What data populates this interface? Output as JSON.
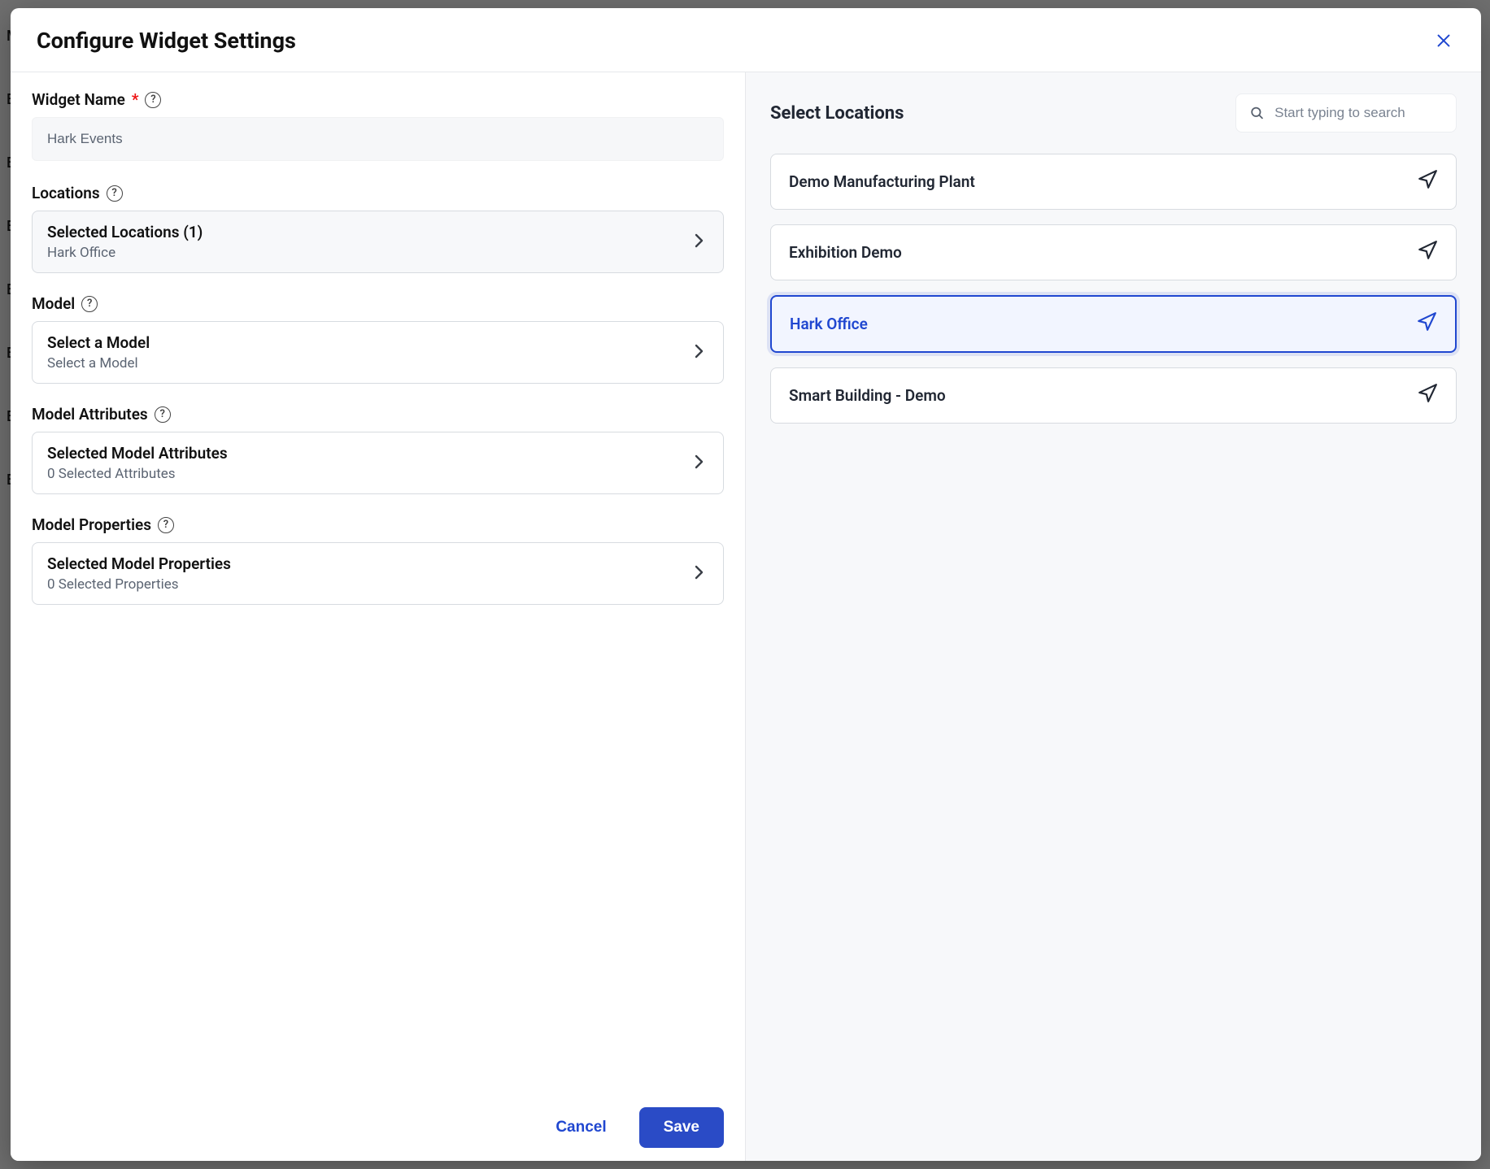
{
  "modal": {
    "title": "Configure Widget Settings"
  },
  "widgetName": {
    "label": "Widget Name",
    "value": "Hark Events"
  },
  "locations": {
    "label": "Locations",
    "cardTitle": "Selected Locations (1)",
    "cardSub": "Hark Office"
  },
  "model": {
    "label": "Model",
    "cardTitle": "Select a Model",
    "cardSub": "Select a Model"
  },
  "modelAttributes": {
    "label": "Model Attributes",
    "cardTitle": "Selected Model Attributes",
    "cardSub": "0 Selected Attributes"
  },
  "modelProperties": {
    "label": "Model Properties",
    "cardTitle": "Selected Model Properties",
    "cardSub": "0 Selected Properties"
  },
  "rightPane": {
    "title": "Select Locations",
    "searchPlaceholder": "Start typing to search",
    "items": [
      {
        "name": "Demo Manufacturing Plant",
        "selected": false
      },
      {
        "name": "Exhibition Demo",
        "selected": false
      },
      {
        "name": "Hark Office",
        "selected": true
      },
      {
        "name": "Smart Building - Demo",
        "selected": false
      }
    ]
  },
  "footer": {
    "cancel": "Cancel",
    "save": "Save"
  }
}
